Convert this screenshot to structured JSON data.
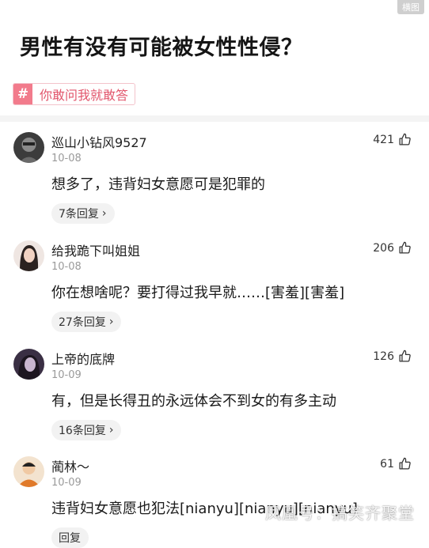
{
  "corner_badge": "横图",
  "question": {
    "title": "男性有没有可能被女性性侵？"
  },
  "topic": {
    "hash": "#",
    "label": "你敢问我就敢答"
  },
  "comments": [
    {
      "user": "巡山小钻风9527",
      "date": "10-08",
      "likes": "421",
      "text": "想多了，违背妇女意愿可是犯罪的",
      "replies": "7条回复",
      "avatar_color": "#4a4a4a"
    },
    {
      "user": "给我跪下叫姐姐",
      "date": "10-08",
      "likes": "206",
      "text": "你在想啥呢？要打得过我早就……[害羞][害羞]",
      "replies": "27条回复",
      "avatar_color": "#d9b8a8"
    },
    {
      "user": "上帝的底牌",
      "date": "10-09",
      "likes": "126",
      "text": "有，但是长得丑的永远体会不到女的有多主动",
      "replies": "16条回复",
      "avatar_color": "#6b5a78"
    },
    {
      "user": "蔺林～",
      "date": "10-09",
      "likes": "61",
      "text": "违背妇女意愿也犯法[nianyu][nianyu][nianyu]",
      "replies": "回复",
      "avatar_color": "#e07a2a"
    }
  ],
  "watermark": "凤凰号：搞笑齐聚堂",
  "icons": {
    "like": "thumbs-up-icon",
    "chevron": "chevron-right-icon",
    "hash": "hash-icon"
  }
}
